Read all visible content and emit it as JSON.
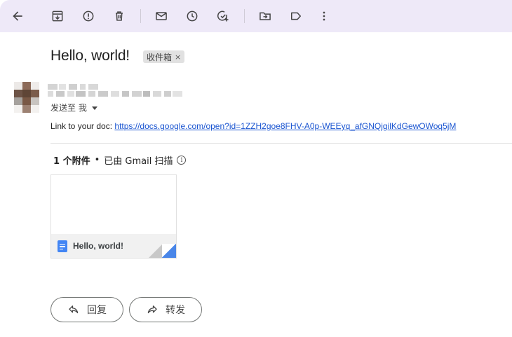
{
  "toolbar": {
    "icons": [
      "back-arrow-icon",
      "archive-icon",
      "report-spam-icon",
      "delete-icon",
      "mark-unread-icon",
      "snooze-icon",
      "add-to-tasks-icon",
      "move-to-icon",
      "label-icon",
      "more-options-icon"
    ]
  },
  "email": {
    "subject": "Hello, world!",
    "label": "收件箱",
    "label_remove": "×",
    "to_line": "发送至 我",
    "body_prefix": "Link to your doc: ",
    "link_url": "https://docs.google.com/open?id=1ZZH2goe8FHV-A0p-WEEyq_afGNQjgilKdGewOWoq5jM"
  },
  "attachments": {
    "count_label": "1 个附件",
    "separator": "•",
    "scan_text": "已由 Gmail 扫描",
    "info_glyph": "i",
    "items": [
      {
        "name": "Hello, world!",
        "icon": "google-docs-icon"
      }
    ]
  },
  "actions": {
    "reply": "回复",
    "forward": "转发"
  },
  "colors": {
    "toolbar_bg": "#eee9f8",
    "link": "#1a55d1",
    "docs_blue": "#4285f4"
  }
}
